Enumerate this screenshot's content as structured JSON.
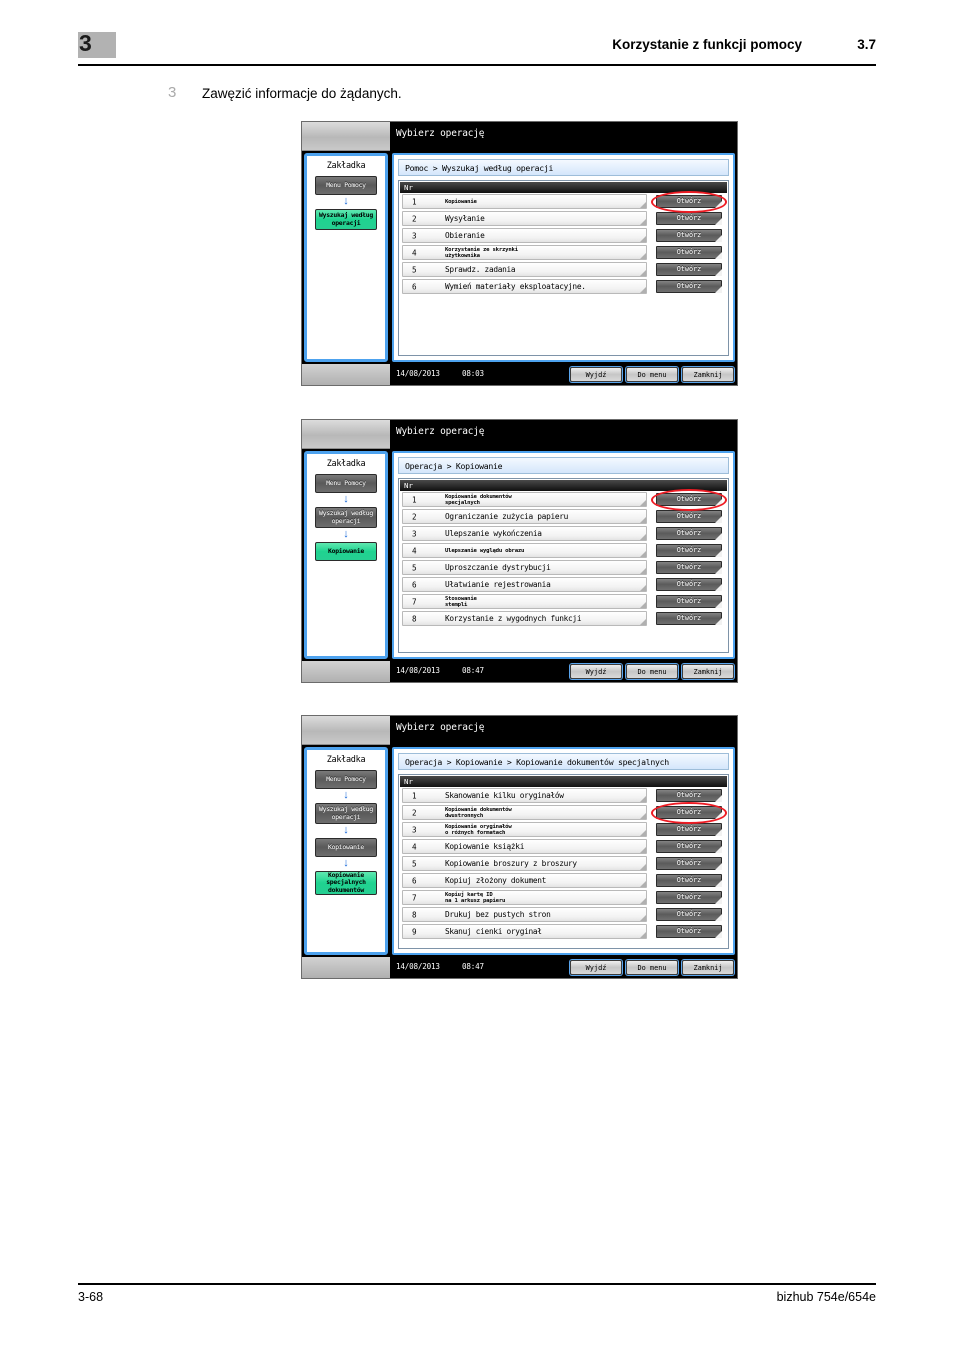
{
  "header": {
    "chapter": "3",
    "title": "Korzystanie z funkcji pomocy",
    "section": "3.7"
  },
  "step": {
    "number": "3",
    "text": "Zawęzić informacje do żądanych."
  },
  "footer": {
    "page": "3-68",
    "model": "bizhub 754e/654e"
  },
  "common": {
    "panel_title": "Wybierz operację",
    "sidebar_title": "Zakładka",
    "list_header": "Nr",
    "open_label": "Otwórz",
    "exit_label": "Wyjdź",
    "menu_label": "Do menu",
    "close_label": "Zamknij",
    "date": "14/08/2013",
    "arrow": "↓"
  },
  "colors": {
    "accent_blue": "#4da2ee",
    "highlight_green": "#1fd390",
    "highlight_red": "#ee1c24",
    "bar_black": "#000000"
  },
  "panels": [
    {
      "id": "panel-1",
      "time": "08:03",
      "breadcrumb": "Pomoc > Wyszukaj według operacji",
      "sidebar_items": [
        {
          "label": "Menu Pomocy",
          "state": "normal",
          "lines": 1
        },
        {
          "label": "Wyszukaj według operacji",
          "state": "active",
          "lines": 2
        }
      ],
      "rows": [
        {
          "no": "1",
          "label": "Kopiowanie",
          "small": true,
          "highlight": false
        },
        {
          "no": "2",
          "label": "Wysyłanie",
          "small": false,
          "highlight": false
        },
        {
          "no": "3",
          "label": "Obieranie",
          "small": false,
          "highlight": false
        },
        {
          "no": "4",
          "label": "Korzystanie ze skrzynki\nużytkownika",
          "small": true,
          "highlight": false
        },
        {
          "no": "5",
          "label": "Sprawdz. zadania",
          "small": false,
          "highlight": false
        },
        {
          "no": "6",
          "label": "Wymień materiały eksploatacyjne.",
          "small": false,
          "highlight": false
        }
      ],
      "highlight_row": 0
    },
    {
      "id": "panel-2",
      "time": "08:47",
      "breadcrumb": "Operacja > Kopiowanie",
      "sidebar_items": [
        {
          "label": "Menu Pomocy",
          "state": "normal",
          "lines": 1
        },
        {
          "label": "Wyszukaj według operacji",
          "state": "normal",
          "lines": 2
        },
        {
          "label": "Kopiowanie",
          "state": "active",
          "lines": 1
        }
      ],
      "rows": [
        {
          "no": "1",
          "label": "Kopiowanie dokumentów\nspecjalnych",
          "small": true,
          "highlight": false
        },
        {
          "no": "2",
          "label": "Ograniczanie zużycia papieru",
          "small": false,
          "highlight": false
        },
        {
          "no": "3",
          "label": "Ulepszanie wykończenia",
          "small": false,
          "highlight": false
        },
        {
          "no": "4",
          "label": "Ulepszanie wyglądu obrazu",
          "small": true,
          "highlight": false
        },
        {
          "no": "5",
          "label": "Uproszczanie dystrybucji",
          "small": false,
          "highlight": false
        },
        {
          "no": "6",
          "label": "Ułatwianie rejestrowania",
          "small": false,
          "highlight": false
        },
        {
          "no": "7",
          "label": "Stosowanie\nstempli",
          "small": true,
          "highlight": false
        },
        {
          "no": "8",
          "label": "Korzystanie z wygodnych funkcji",
          "small": false,
          "highlight": false
        }
      ],
      "highlight_row": 0
    },
    {
      "id": "panel-3",
      "time": "08:47",
      "breadcrumb": "Operacja > Kopiowanie > Kopiowanie dokumentów specjalnych",
      "sidebar_items": [
        {
          "label": "Menu Pomocy",
          "state": "normal",
          "lines": 1
        },
        {
          "label": "Wyszukaj według operacji",
          "state": "normal",
          "lines": 2
        },
        {
          "label": "Kopiowanie",
          "state": "normal",
          "lines": 1
        },
        {
          "label": "Kopiowanie specjalnych dokumentów",
          "state": "active",
          "lines": 3
        }
      ],
      "rows": [
        {
          "no": "1",
          "label": "Skanowanie kilku oryginałów",
          "small": false,
          "highlight": false
        },
        {
          "no": "2",
          "label": "Kopiowanie dokumentów\ndwustronnych",
          "small": true,
          "highlight": false
        },
        {
          "no": "3",
          "label": "Kopiowanie oryginałów\no różnych formatach",
          "small": true,
          "highlight": false
        },
        {
          "no": "4",
          "label": "Kopiowanie książki",
          "small": false,
          "highlight": false
        },
        {
          "no": "5",
          "label": "Kopiowanie broszury z broszury",
          "small": false,
          "highlight": false
        },
        {
          "no": "6",
          "label": "Kopiuj złożony dokument",
          "small": false,
          "highlight": false
        },
        {
          "no": "7",
          "label": "Kopiuj kartę ID\nna 1 arkusz papieru",
          "small": true,
          "highlight": false
        },
        {
          "no": "8",
          "label": "Drukuj bez pustych stron",
          "small": false,
          "highlight": false
        },
        {
          "no": "9",
          "label": "Skanuj cienki oryginał",
          "small": false,
          "highlight": false
        }
      ],
      "highlight_row": 1
    }
  ]
}
